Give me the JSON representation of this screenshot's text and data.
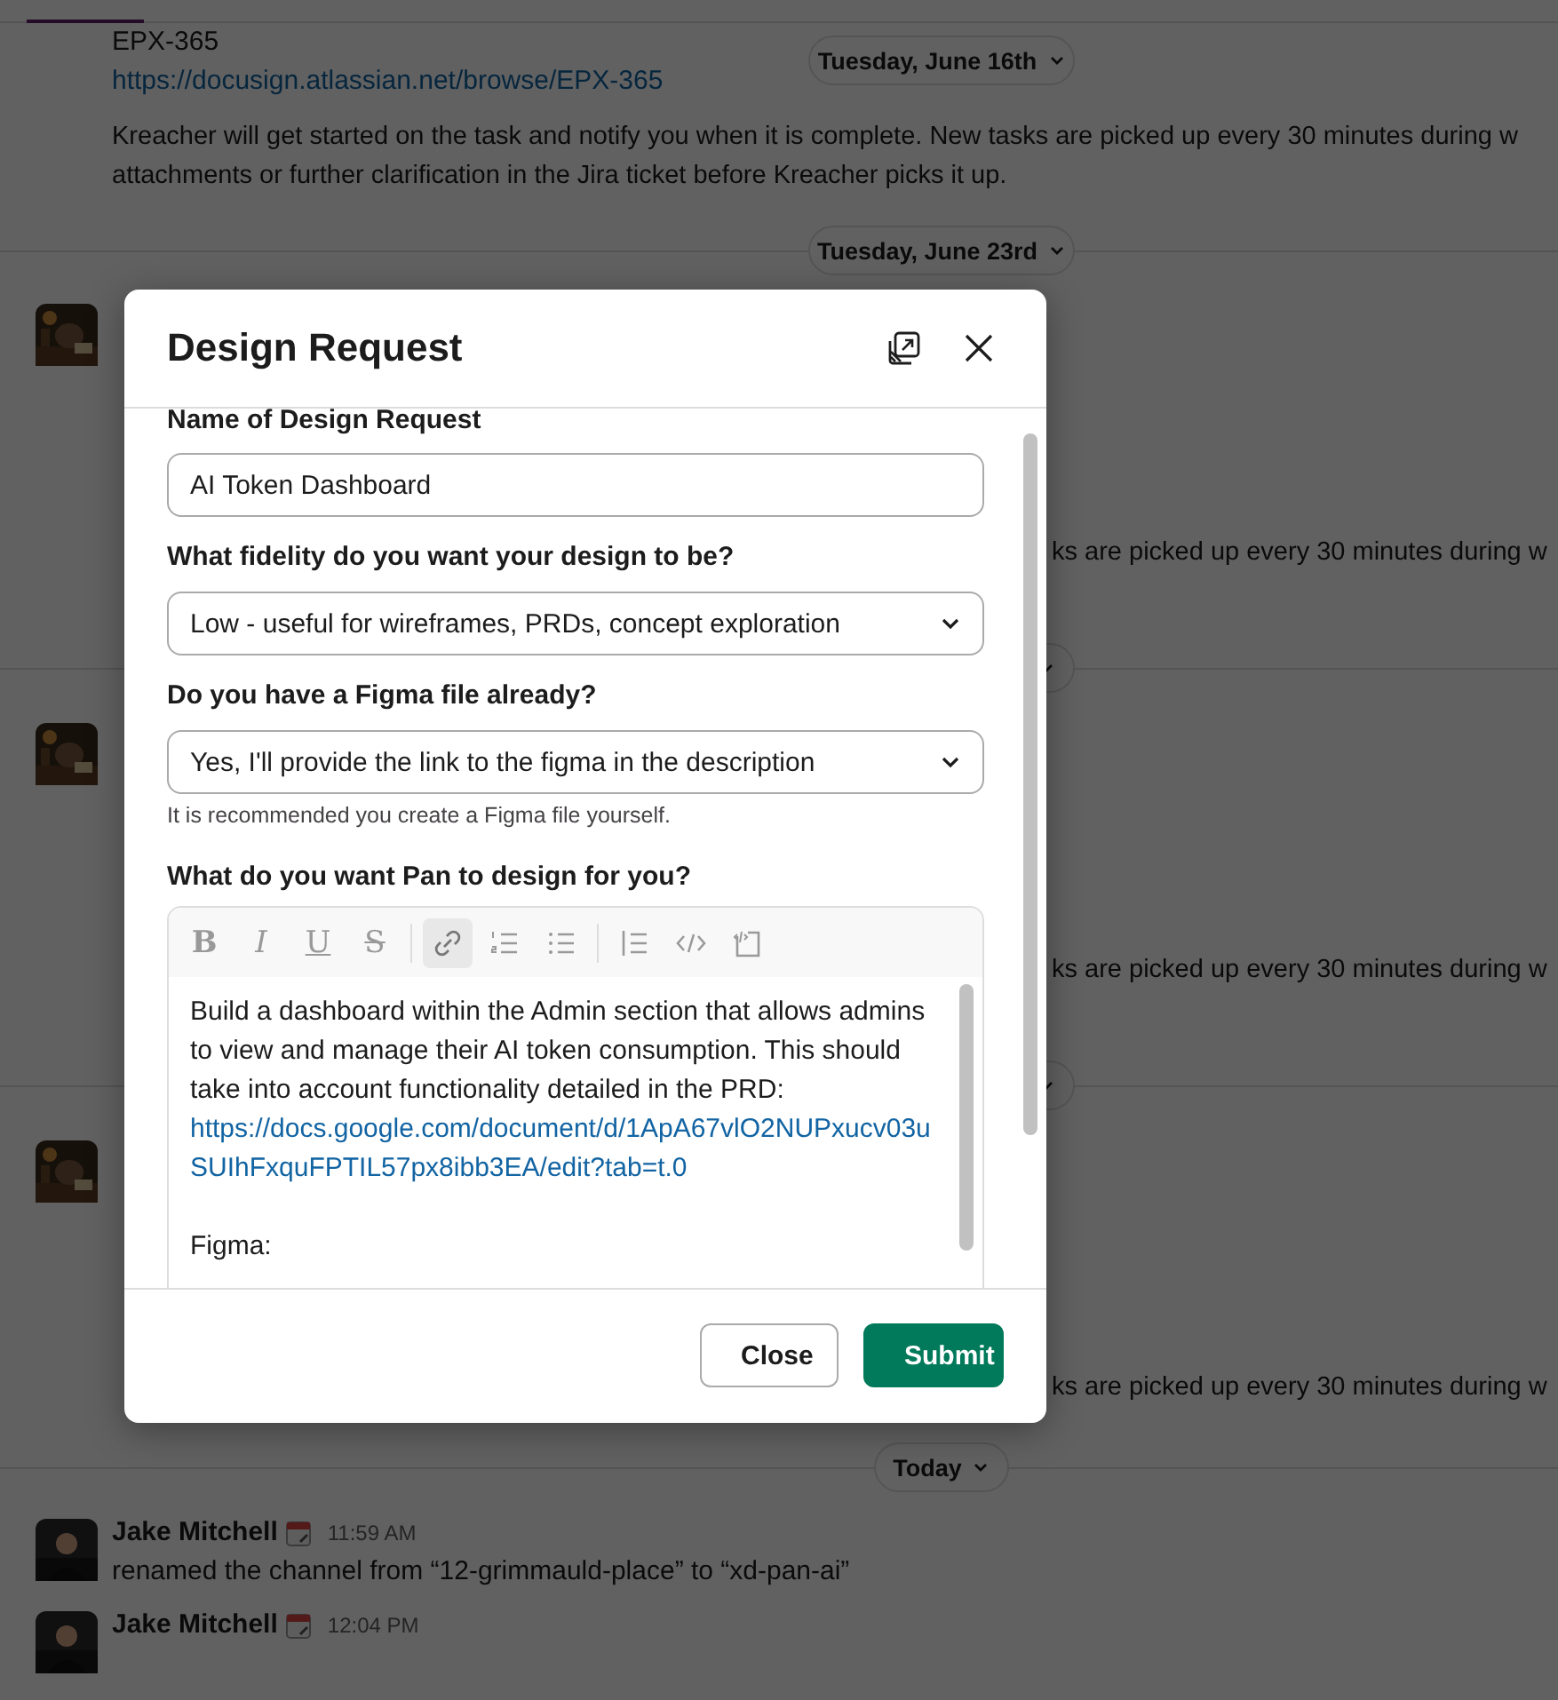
{
  "channel": {
    "top_message": {
      "title": "EPX-365",
      "link": "https://docusign.atlassian.net/browse/EPX-365",
      "lines": [
        "Kreacher will get started on the task and notify you when it is complete. New tasks are picked up every 30 minutes during w",
        "attachments or further clarification in the Jira ticket before Kreacher picks it up."
      ]
    },
    "sticky_date": "Tuesday, June 16th",
    "date_divider": "Tuesday, June 23rd",
    "hidden_messages": [
      {
        "fragment": "ks are picked up every 30 minutes during w"
      },
      {
        "fragment": "ks are picked up every 30 minutes during w"
      },
      {
        "fragment": "ks are picked up every 30 minutes during w"
      }
    ],
    "today_divider": "Today",
    "messages": [
      {
        "author": "Jake Mitchell",
        "time": "11:59 AM",
        "text": "renamed the channel from “12-grimmauld-place” to “xd-pan-ai”"
      },
      {
        "author": "Jake Mitchell",
        "time": "12:04 PM"
      }
    ]
  },
  "modal": {
    "title": "Design Request",
    "fields": [
      {
        "kind": "text",
        "label": "Name of Design Request",
        "value": "AI Token Dashboard"
      },
      {
        "kind": "select",
        "label": "What fidelity do you want your design to be?",
        "value": "Low - useful for wireframes, PRDs, concept exploration"
      },
      {
        "kind": "select",
        "label": "Do you have a Figma file already?",
        "value": "Yes, I'll provide the link to the figma in the description",
        "hint": "It is recommended you create a Figma file yourself."
      },
      {
        "kind": "editor",
        "label": "What do you want Pan to design for you?",
        "toolbar": [
          {
            "kind": "bold",
            "label": "B",
            "selected": false
          },
          {
            "kind": "italic",
            "label": "I",
            "selected": false
          },
          {
            "kind": "underline",
            "label": "U",
            "selected": false
          },
          {
            "kind": "strike",
            "label": "S",
            "selected": false
          },
          {
            "kind": "separator"
          },
          {
            "kind": "link",
            "selected": true
          },
          {
            "kind": "ordered-list",
            "selected": false
          },
          {
            "kind": "bullet-list",
            "selected": false
          },
          {
            "kind": "separator"
          },
          {
            "kind": "blockquote",
            "selected": false
          },
          {
            "kind": "code",
            "selected": false
          },
          {
            "kind": "code-block",
            "selected": false
          }
        ],
        "content": [
          {
            "kind": "text",
            "text": "Build a dashboard within the Admin section that allows admins to view and manage their AI token consumption. This should take into account functionality detailed in the PRD:"
          },
          {
            "kind": "link",
            "text": "https://docs.google.com/document/d/1ApA67vlO2NUPxucv03uSUIhFxquFPTIL57px8ibb3EA/edit?tab=t.0"
          },
          {
            "kind": "blank"
          },
          {
            "kind": "text",
            "text": "Figma:"
          }
        ]
      }
    ],
    "buttons": [
      {
        "kind": "secondary",
        "label": "Close"
      },
      {
        "kind": "primary",
        "label": "Submit"
      }
    ]
  }
}
